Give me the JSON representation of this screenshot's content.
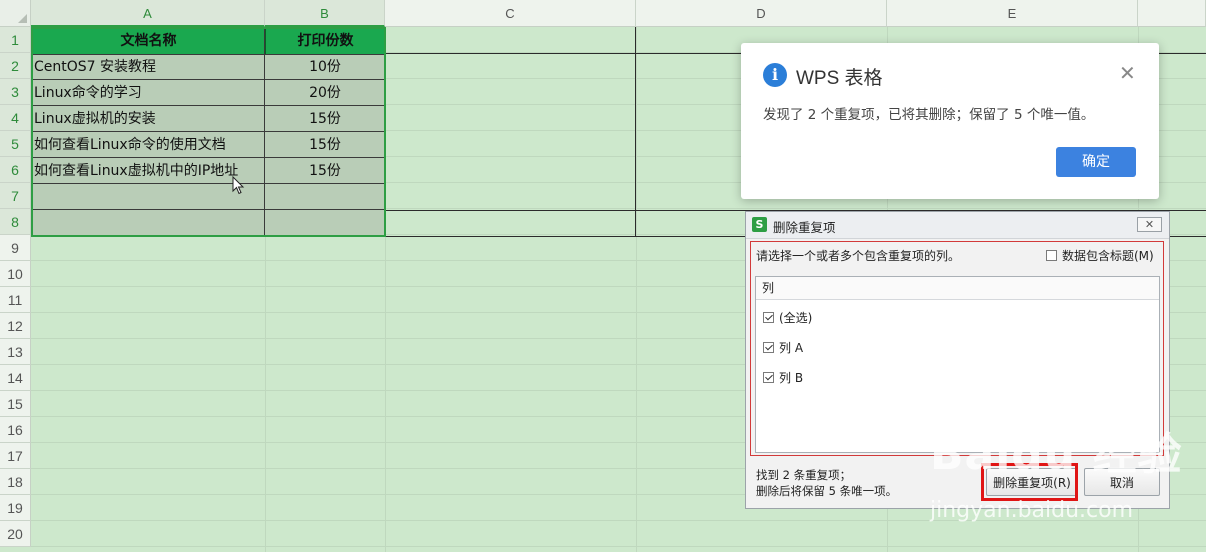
{
  "columns": [
    "A",
    "B",
    "C",
    "D",
    "E"
  ],
  "rows": [
    "1",
    "2",
    "3",
    "4",
    "5",
    "6",
    "7",
    "8",
    "9",
    "10",
    "11",
    "12",
    "13",
    "14",
    "15",
    "16",
    "17",
    "18",
    "19",
    "20"
  ],
  "table": {
    "headers": [
      "文档名称",
      "打印份数"
    ],
    "data": [
      [
        "CentOS7 安装教程",
        "10份"
      ],
      [
        "Linux命令的学习",
        "20份"
      ],
      [
        "Linux虚拟机的安装",
        "15份"
      ],
      [
        "如何查看Linux命令的使用文档",
        "15份"
      ],
      [
        "如何查看Linux虚拟机中的IP地址",
        "15份"
      ]
    ]
  },
  "toast": {
    "icon": "info-icon",
    "title": "WPS 表格",
    "message": "发现了 2 个重复项，已将其删除；保留了 5 个唯一值。",
    "ok_label": "确定",
    "close_glyph": "✕"
  },
  "dialog": {
    "title": "删除重复项",
    "logo": "S",
    "close_glyph": "✕",
    "instruction": "请选择一个或者多个包含重复项的列。",
    "header_checkbox_label": "数据包含标题(M)",
    "header_checkbox_checked": false,
    "list_header": "列",
    "items": [
      {
        "label": "(全选)",
        "checked": true
      },
      {
        "label": "列 A",
        "checked": true
      },
      {
        "label": "列 B",
        "checked": true
      }
    ],
    "found_line1": "找到 2 条重复项；",
    "found_line2": "删除后将保留 5 条唯一项。",
    "delete_label": "删除重复项(R)",
    "cancel_label": "取消"
  },
  "watermark": {
    "text": "Baidu 经验",
    "url": "jingyan.baidu.com"
  },
  "colors": {
    "sheet_bg": "#cde8cc",
    "header_fill": "#1aa84f",
    "selection": "#2e9e44",
    "ok_button": "#3c82e0",
    "highlight": "#e01515"
  }
}
